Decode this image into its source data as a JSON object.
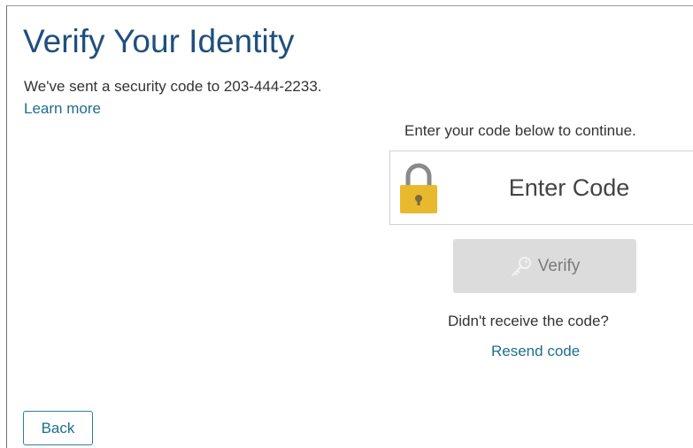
{
  "page": {
    "title": "Verify Your Identity",
    "sent_message": "We've sent a security code to 203-444-2233.",
    "learn_more_label": "Learn more"
  },
  "code_entry": {
    "instruction": "Enter your code below to continue.",
    "input_placeholder": "Enter Code",
    "input_value": "",
    "icon": "lock-icon"
  },
  "verify": {
    "label": "Verify",
    "icon": "key-icon",
    "enabled": false
  },
  "resend": {
    "prompt": "Didn't receive the code?",
    "link_label": "Resend code"
  },
  "nav": {
    "back_label": "Back"
  },
  "colors": {
    "title": "#1f4f7d",
    "link": "#1e6e8f",
    "lock_body": "#e8b92d",
    "lock_shackle": "#8a8a8a",
    "button_disabled_bg": "#dcdcdc"
  }
}
